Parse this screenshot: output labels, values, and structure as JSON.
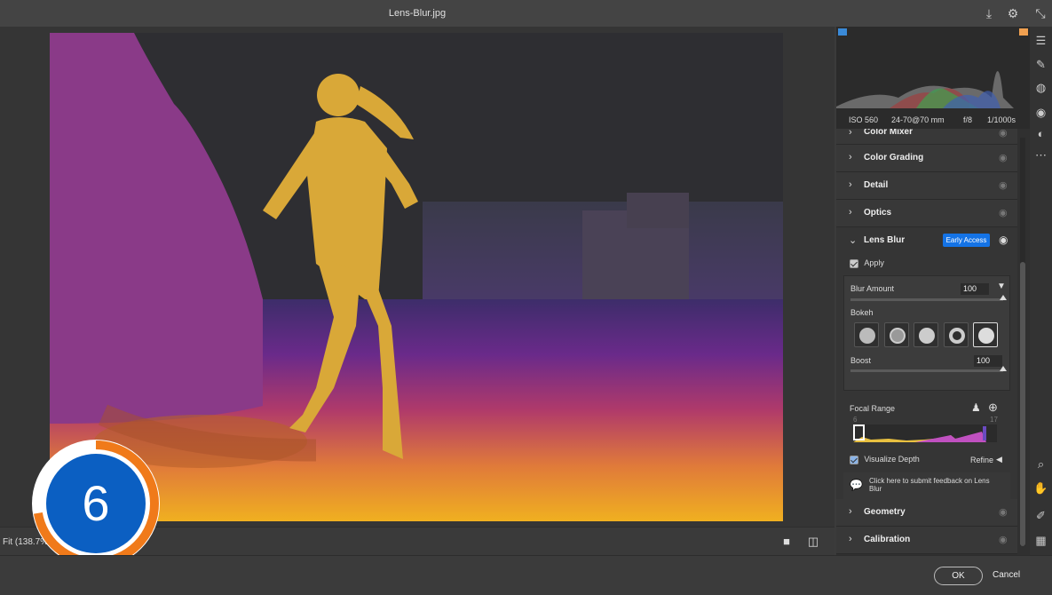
{
  "titlebar": {
    "title": "Lens-Blur.jpg"
  },
  "histogram": {
    "exif": {
      "iso": "ISO 560",
      "lens": "24-70@70 mm",
      "aperture": "f/8",
      "shutter": "1/1000s"
    }
  },
  "sections_top": [
    "Color Mixer",
    "Color Grading",
    "Detail",
    "Optics"
  ],
  "lens_blur": {
    "title": "Lens Blur",
    "badge": "Early Access",
    "apply_label": "Apply",
    "apply_checked": true,
    "blur_amount_label": "Blur Amount",
    "blur_amount_value": "100",
    "bokeh_label": "Bokeh",
    "bokeh_selected_index": 4,
    "boost_label": "Boost",
    "boost_value": "100",
    "focal_range_label": "Focal Range",
    "focal_min": "6",
    "focal_max": "17",
    "visualize_depth_label": "Visualize Depth",
    "visualize_depth_checked": true,
    "refine_label": "Refine",
    "feedback_text": "Click here to submit feedback on Lens Blur"
  },
  "sections_bottom": [
    "Geometry",
    "Calibration"
  ],
  "canvas_footer": {
    "zoom_label": "Fit (138.7%)"
  },
  "badge": {
    "number": "6"
  },
  "buttons": {
    "ok": "OK",
    "cancel": "Cancel"
  },
  "colors": {
    "accent": "#1473e6",
    "depth_near": "#e8b038",
    "depth_far": "#4a2a6e",
    "badge_ring": "#f07a1a",
    "badge_fill": "#0b5fc2"
  }
}
